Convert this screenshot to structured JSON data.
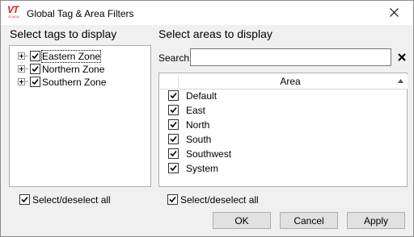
{
  "window": {
    "title": "Global Tag & Area Filters",
    "logo_text": "VT",
    "logo_subtext": "SCADA"
  },
  "tags": {
    "heading": "Select tags to display",
    "items": [
      {
        "label": "Eastern Zone",
        "checked": true
      },
      {
        "label": "Northern Zone",
        "checked": true
      },
      {
        "label": "Southern Zone",
        "checked": true
      }
    ],
    "select_all_label": "Select/deselect all"
  },
  "areas": {
    "heading": "Select areas to display",
    "search_label": "Search",
    "search_value": "",
    "column_header": "Area",
    "items": [
      {
        "label": "Default",
        "checked": true
      },
      {
        "label": "East",
        "checked": true
      },
      {
        "label": "North",
        "checked": true
      },
      {
        "label": "South",
        "checked": true
      },
      {
        "label": "Southwest",
        "checked": true
      },
      {
        "label": "System",
        "checked": true
      }
    ],
    "select_all_label": "Select/deselect all"
  },
  "buttons": {
    "ok": "OK",
    "cancel": "Cancel",
    "apply": "Apply"
  },
  "icons": {
    "close": "close-icon",
    "clear_search": "clear-search-icon",
    "sort": "sort-ascending-icon",
    "expander": "plus-expander-icon",
    "checkbox": "checkmark-icon"
  }
}
